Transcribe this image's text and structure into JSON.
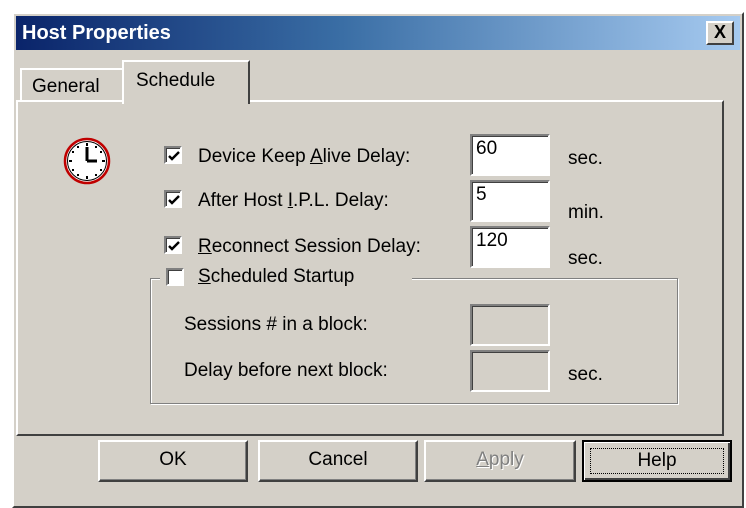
{
  "window": {
    "title": "Host Properties",
    "close_label": "X"
  },
  "tabs": [
    {
      "label": "General",
      "active": false
    },
    {
      "label": "Schedule",
      "active": true
    }
  ],
  "settings": {
    "keep_alive": {
      "label_pre": "Device Keep ",
      "label_u": "A",
      "label_post": "live Delay:",
      "checked": true,
      "value": "60",
      "unit": "sec."
    },
    "ipl": {
      "label_pre": "After Host ",
      "label_u": "I",
      "label_post": ".P.L. Delay:",
      "checked": true,
      "value": "5",
      "unit": "min."
    },
    "reconnect": {
      "label_pre": "",
      "label_u": "R",
      "label_post": "econnect Session Delay:",
      "checked": true,
      "value": "120",
      "unit": "sec."
    }
  },
  "scheduled_startup": {
    "label_pre": "",
    "label_u": "S",
    "label_post": "cheduled Startup",
    "checked": false,
    "sessions_label": "Sessions # in a block:",
    "sessions_value": "",
    "delay_label": "Delay before next block:",
    "delay_value": "",
    "delay_unit": "sec."
  },
  "buttons": {
    "ok": "OK",
    "cancel": "Cancel",
    "apply_u": "A",
    "apply_rest": "pply",
    "help": "Help"
  },
  "icons": {
    "clock": "clock-icon",
    "check": "checkmark-icon"
  },
  "colors": {
    "title_start": "#0a246a",
    "title_end": "#a6caf0",
    "face": "#d4d0c8",
    "clock_rim": "#c00000"
  }
}
